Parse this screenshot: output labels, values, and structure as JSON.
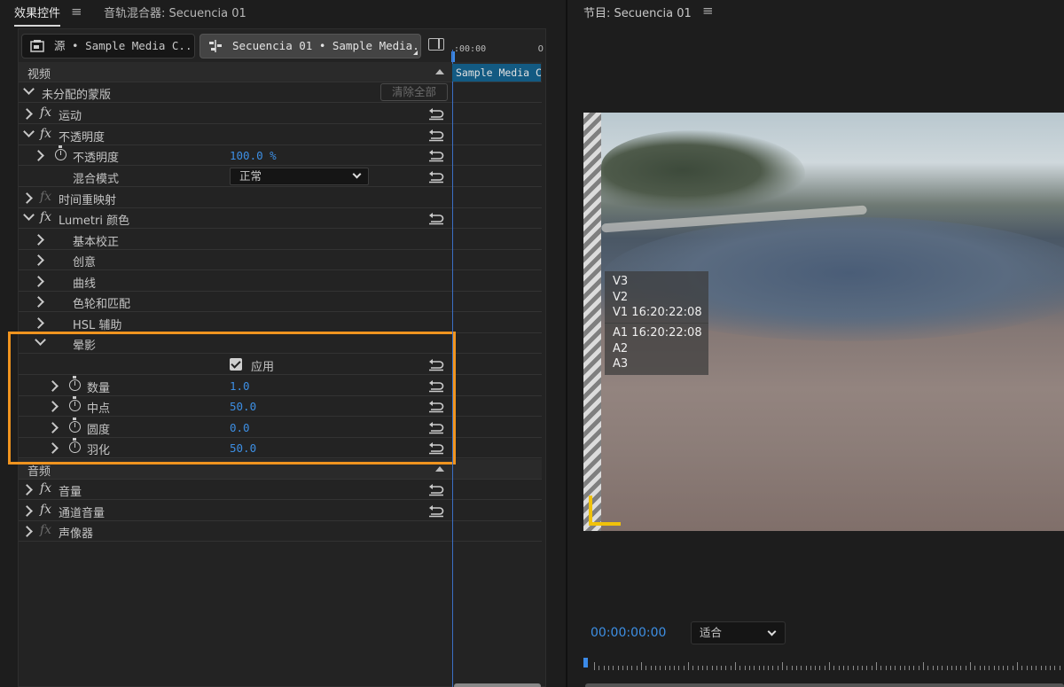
{
  "top_tabs": {
    "effects_controls": "效果控件",
    "audio_mixer": "音轨混合器: Secuencia 01"
  },
  "clip_selector": {
    "source_label": "源 • Sample Media C...",
    "sequence_label": "Secuencia 01 • Sample Media..."
  },
  "mini_timeline": {
    "start_time": ":00:00",
    "end_time": "0",
    "clip_label": "Sample Media C"
  },
  "effects": {
    "video_header": "视频",
    "mask_group": "未分配的蒙版",
    "clear_all_button": "清除全部",
    "motion": "运动",
    "opacity": "不透明度",
    "opacity_param": "不透明度",
    "opacity_value": "100.0 %",
    "blend_mode_label": "混合模式",
    "blend_mode_value": "正常",
    "time_remap": "时间重映射",
    "lumetri": "Lumetri 颜色",
    "basic_correction": "基本校正",
    "creative": "创意",
    "curves": "曲线",
    "color_wheels": "色轮和匹配",
    "hsl": "HSL 辅助",
    "vignette": "晕影",
    "apply_label": "应用",
    "amount_label": "数量",
    "amount_value": "1.0",
    "midpoint_label": "中点",
    "midpoint_value": "50.0",
    "roundness_label": "圆度",
    "roundness_value": "0.0",
    "feather_label": "羽化",
    "feather_value": "50.0",
    "audio_header": "音频",
    "volume": "音量",
    "channel_volume": "通道音量",
    "panner": "声像器"
  },
  "program": {
    "title": "节目: Secuencia 01",
    "overlay_video": [
      "V3",
      "V2",
      "V1 16:20:22:08"
    ],
    "overlay_audio": [
      "A1 16:20:22:08",
      "A2",
      "A3"
    ],
    "timecode": "00:00:00:00",
    "fit_value": "适合"
  },
  "colors": {
    "accent_blue": "#3d8fe4",
    "highlight_orange": "#f0941f",
    "clip_blue": "#135a82",
    "safe_margin_yellow": "#f0c20a"
  }
}
